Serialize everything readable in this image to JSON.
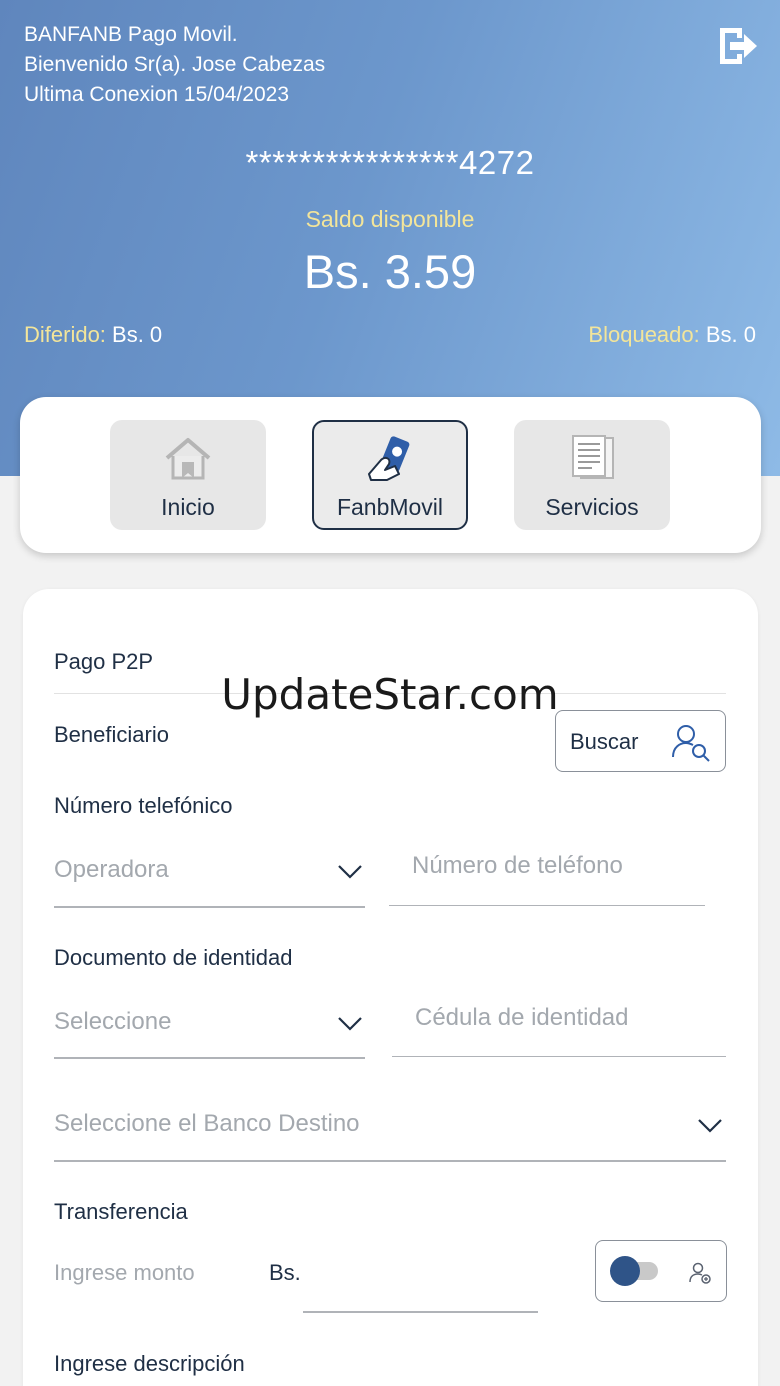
{
  "header": {
    "app_title": "BANFANB Pago Movil.",
    "welcome": "Bienvenido Sr(a). Jose Cabezas",
    "last_connection": "Ultima Conexion 15/04/2023",
    "account_masked": "****************4272",
    "balance_label": "Saldo disponible",
    "balance_value": "Bs. 3.59",
    "diferido_label": "Diferido:",
    "diferido_value": " Bs. 0",
    "bloqueado_label": "Bloqueado:",
    "bloqueado_value": " Bs. 0"
  },
  "nav": {
    "items": [
      {
        "label": "Inicio",
        "icon": "home-icon"
      },
      {
        "label": "FanbMovil",
        "icon": "phone-payment-icon"
      },
      {
        "label": "Servicios",
        "icon": "document-icon"
      }
    ],
    "active": "FanbMovil"
  },
  "form": {
    "section_title": "Pago P2P",
    "beneficiario_label": "Beneficiario",
    "buscar_label": "Buscar",
    "telefono_label": "Número telefónico",
    "operadora_placeholder": "Operadora",
    "telefono_placeholder": "Número de teléfono",
    "documento_label": "Documento de identidad",
    "doc_type_placeholder": "Seleccione",
    "cedula_placeholder": "Cédula de identidad",
    "banco_placeholder": "Seleccione el Banco Destino",
    "transferencia_label": "Transferencia",
    "monto_label": "Ingrese monto",
    "currency": "Bs.",
    "descripcion_label": "Ingrese descripción"
  },
  "watermark": "UpdateStar.com",
  "colors": {
    "header_gradient_start": "#5f86bd",
    "header_gradient_end": "#8ebae6",
    "accent_yellow": "#f3e59a",
    "text_dark": "#1f2f45",
    "toggle_knob": "#2f5488"
  }
}
